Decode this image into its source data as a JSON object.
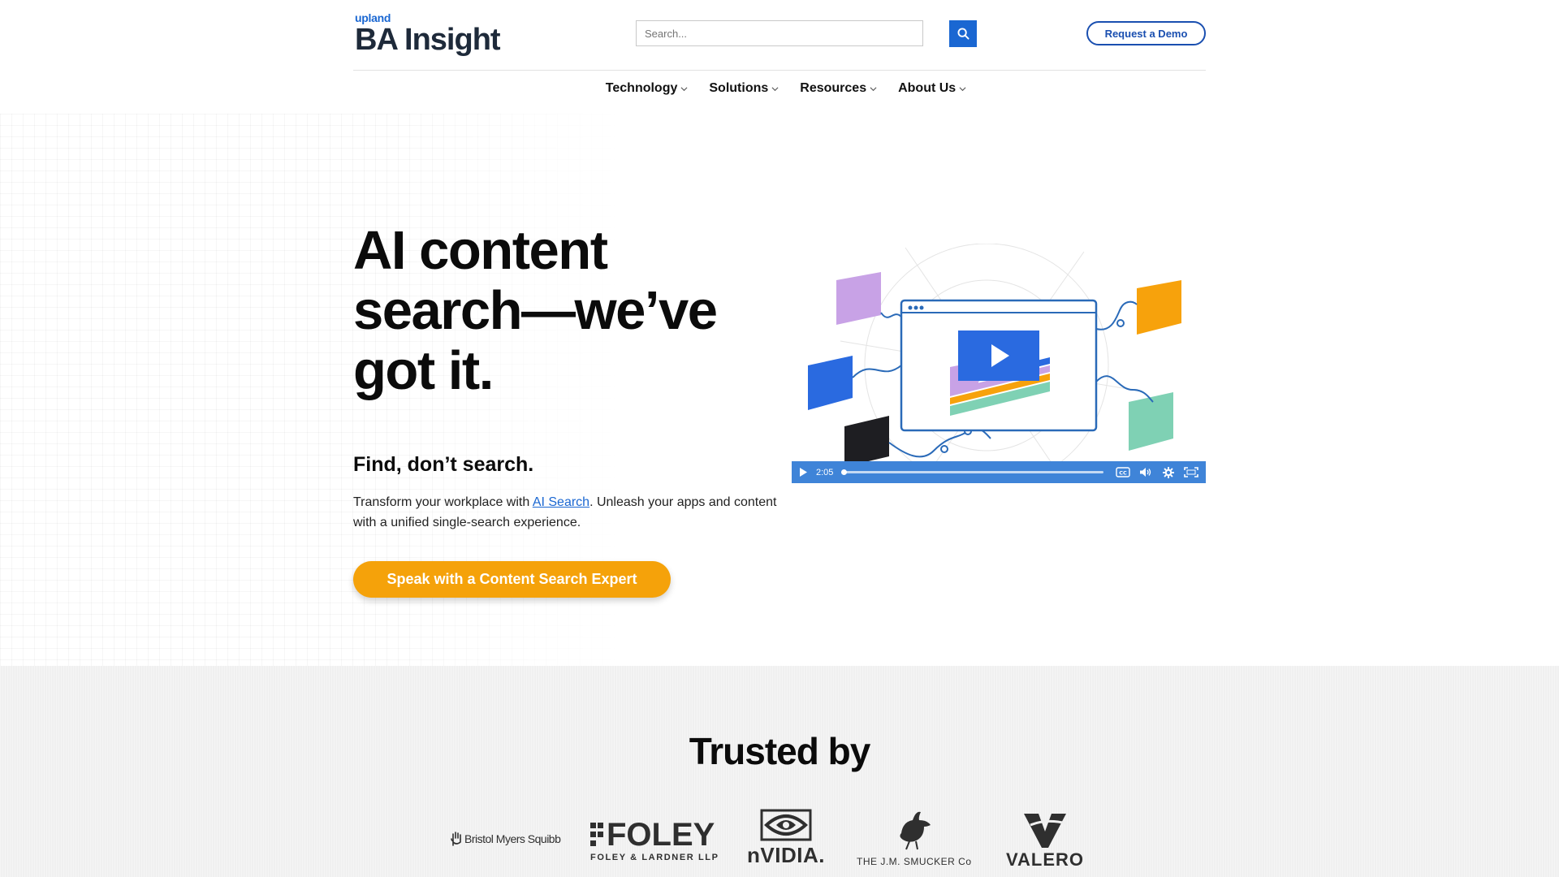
{
  "brand": {
    "parent": "upland",
    "name": "BA Insight"
  },
  "search": {
    "placeholder": "Search...",
    "button_icon": "search-icon"
  },
  "header": {
    "demo_label": "Request a Demo"
  },
  "nav": {
    "items": [
      {
        "label": "Technology"
      },
      {
        "label": "Solutions"
      },
      {
        "label": "Resources"
      },
      {
        "label": "About Us"
      }
    ]
  },
  "hero": {
    "title": "AI content search—we’ve got it.",
    "subtitle": "Find, don’t search.",
    "body_before": "Transform your workplace with ",
    "body_link": "AI Search",
    "body_after": ". Unleash your apps and content with a unified single-search experience.",
    "cta_label": "Speak with a Content Search Expert"
  },
  "video": {
    "duration": "2:05",
    "progress": 0,
    "controls": [
      "play-icon",
      "closed-captions-icon",
      "volume-icon",
      "settings-icon",
      "fullscreen-icon"
    ]
  },
  "trusted": {
    "title": "Trusted by",
    "logos": [
      {
        "name": "Bristol Myers Squibb",
        "text": "Bristol Myers Squibb"
      },
      {
        "name": "Foley & Lardner LLP",
        "text": "FOLEY",
        "subtext": "FOLEY & LARDNER LLP"
      },
      {
        "name": "NVIDIA",
        "text": "nVIDIA."
      },
      {
        "name": "The J.M. Smucker Co",
        "text": "THE J.M. SMUCKER Co"
      },
      {
        "name": "Valero",
        "text": "VALERO"
      }
    ]
  },
  "colors": {
    "brand_blue": "#1a67d2",
    "cta_orange": "#f5a20a",
    "video_bar": "#3f84d8",
    "trusted_bg": "#f0f0f0"
  }
}
